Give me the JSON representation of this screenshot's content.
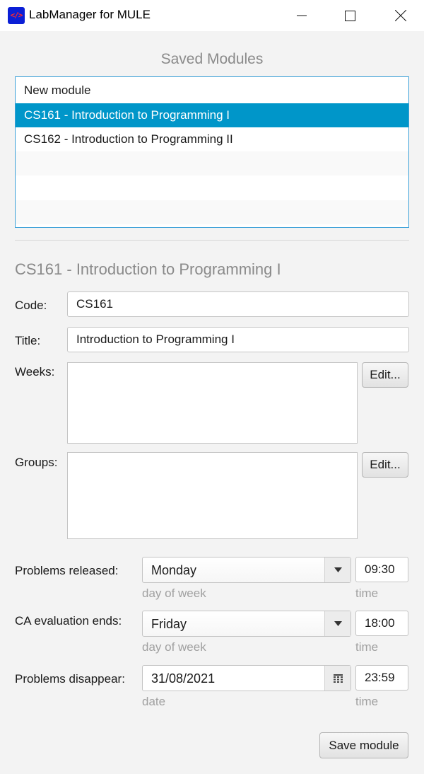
{
  "window": {
    "title": "LabManager for MULE",
    "icon": "code-icon"
  },
  "saved_modules": {
    "heading": "Saved Modules",
    "items": [
      {
        "label": "New module",
        "selected": false
      },
      {
        "label": "CS161 - Introduction to Programming I",
        "selected": true
      },
      {
        "label": "CS162 - Introduction to Programming II",
        "selected": false
      }
    ]
  },
  "module": {
    "heading": "CS161 - Introduction to Programming I",
    "code_label": "Code:",
    "code_value": "CS161",
    "title_label": "Title:",
    "title_value": "Introduction to Programming I",
    "weeks_label": "Weeks:",
    "weeks_edit": "Edit...",
    "groups_label": "Groups:",
    "groups_edit": "Edit..."
  },
  "schedule": {
    "released": {
      "label": "Problems released:",
      "day": "Monday",
      "time": "09:30",
      "day_hint": "day of week",
      "time_hint": "time"
    },
    "ca_ends": {
      "label": "CA evaluation ends:",
      "day": "Friday",
      "time": "18:00",
      "day_hint": "day of week",
      "time_hint": "time"
    },
    "disappear": {
      "label": "Problems disappear:",
      "date": "31/08/2021",
      "time": "23:59",
      "date_hint": "date",
      "time_hint": "time"
    }
  },
  "save_button": "Save module",
  "colors": {
    "selection": "#0096c9",
    "list_focus_border": "#3aa0d8",
    "app_icon_bg": "#0b1fd6"
  }
}
